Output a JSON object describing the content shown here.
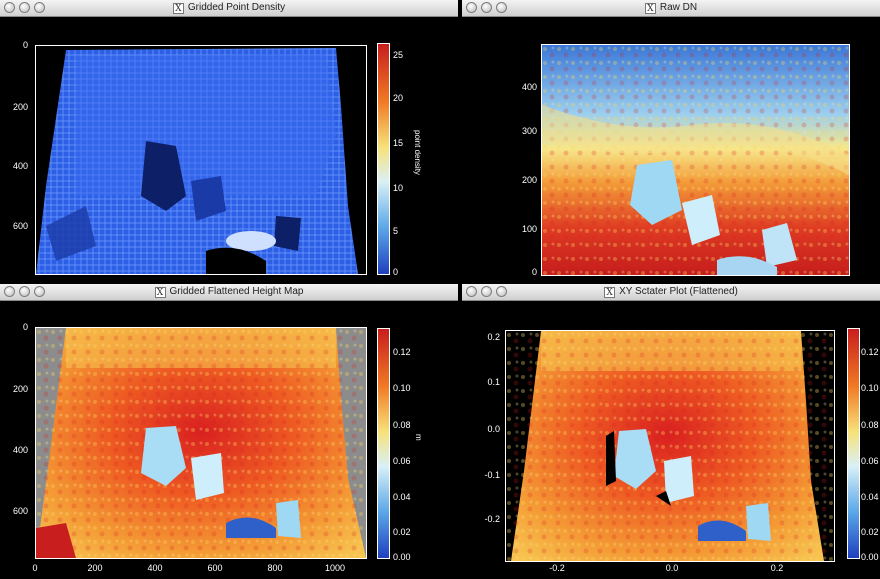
{
  "windows": [
    {
      "title": "Gridded Point Density",
      "y_ticks": [
        "0",
        "200",
        "400",
        "600"
      ],
      "x_ticks": [],
      "colorbar_ticks": [
        "25",
        "20",
        "15",
        "10",
        "5",
        "0"
      ],
      "colorbar_label": "point density"
    },
    {
      "title": "Raw DN",
      "y_ticks": [
        "400",
        "300",
        "200",
        "100",
        "0"
      ],
      "x_ticks": [],
      "colorbar_ticks": [],
      "colorbar_label": ""
    },
    {
      "title": "Gridded Flattened Height Map",
      "y_ticks": [
        "0",
        "200",
        "400",
        "600"
      ],
      "x_ticks": [
        "0",
        "200",
        "400",
        "600",
        "800",
        "1000"
      ],
      "colorbar_ticks": [
        "0.12",
        "0.10",
        "0.08",
        "0.06",
        "0.04",
        "0.02",
        "0.00"
      ],
      "colorbar_label": "m"
    },
    {
      "title": "XY Sctater Plot (Flattened)",
      "y_ticks": [
        "0.2",
        "0.1",
        "0.0",
        "-0.1",
        "-0.2"
      ],
      "x_ticks": [
        "-0.2",
        "0.0",
        "0.2"
      ],
      "colorbar_ticks": [
        "0.12",
        "0.10",
        "0.08",
        "0.06",
        "0.04",
        "0.02",
        "0.00"
      ],
      "colorbar_label": ""
    }
  ],
  "colors": {
    "density_blue": "#2b5ef0",
    "heat_red": "#d81e1e",
    "heat_orange": "#f07a24",
    "heat_yellow": "#f7d55a",
    "cool_lightblue": "#bfe4f7",
    "cool_blue": "#3d7fd6",
    "masked_gray": "#8c8c8c"
  },
  "icons": [
    "close-button-icon",
    "minimize-button-icon",
    "zoom-button-icon",
    "x11-icon"
  ]
}
